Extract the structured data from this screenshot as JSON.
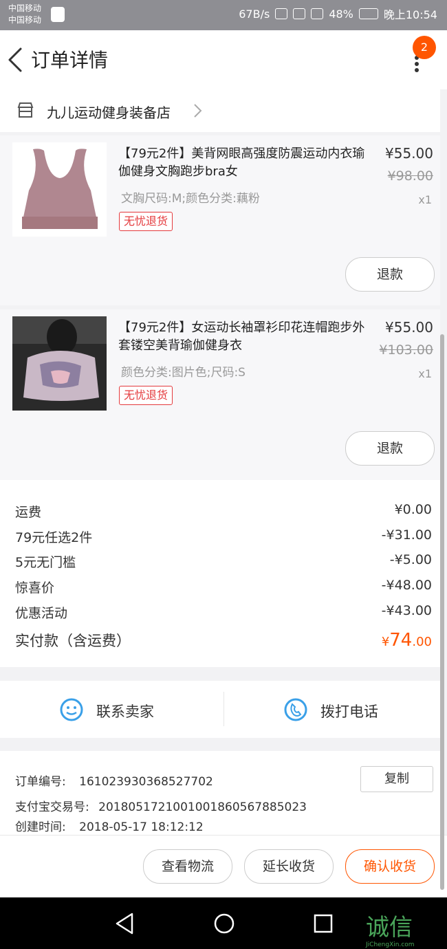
{
  "status_bar": {
    "carrier1": "中国移动",
    "carrier2": "中国移动",
    "speed": "67B/s",
    "battery": "48%",
    "time": "晚上10:54"
  },
  "header": {
    "title": "订单详情",
    "badge": "2"
  },
  "store": {
    "name": "九儿运动健身装备店"
  },
  "items": [
    {
      "title": "【79元2件】美背网眼高强度防震运动内衣瑜伽健身文胸跑步bra女",
      "price": "¥55.00",
      "old_price": "¥98.00",
      "qty": "x1",
      "sku": "文胸尺码:M;颜色分类:藕粉",
      "tag": "无忧退货",
      "refund": "退款"
    },
    {
      "title": "【79元2件】女运动长袖罩衫印花连帽跑步外套镂空美背瑜伽健身衣",
      "price": "¥55.00",
      "old_price": "¥103.00",
      "qty": "x1",
      "sku": "颜色分类:图片色;尺码:S",
      "tag": "无忧退货",
      "refund": "退款"
    }
  ],
  "costs": [
    {
      "label": "运费",
      "value": "¥0.00"
    },
    {
      "label": "79元任选2件",
      "value": "-¥31.00"
    },
    {
      "label": "5元无门槛",
      "value": "-¥5.00"
    },
    {
      "label": "惊喜价",
      "value": "-¥48.00"
    },
    {
      "label": "优惠活动",
      "value": "-¥43.00"
    }
  ],
  "total": {
    "label": "实付款（含运费）",
    "currency": "¥",
    "integer": "74",
    "decimal": ".00"
  },
  "contact": {
    "seller": "联系卖家",
    "phone": "拨打电话"
  },
  "order_info": {
    "order_no_label": "订单编号:",
    "order_no": "161023930368527702",
    "copy": "复制",
    "alipay_label": "支付宝交易号:",
    "alipay_no": "2018051721001001860567885023",
    "created_label": "创建时间:",
    "created": "2018-05-17 18:12:12"
  },
  "actions": {
    "logistics": "查看物流",
    "extend": "延长收货",
    "confirm": "确认收货"
  },
  "watermark": {
    "text": "诚信",
    "sub": "JiChengXin.com"
  },
  "colors": {
    "accent": "#ff5500",
    "tag_red": "#e4393c",
    "contact_blue": "#3aa0e8"
  }
}
